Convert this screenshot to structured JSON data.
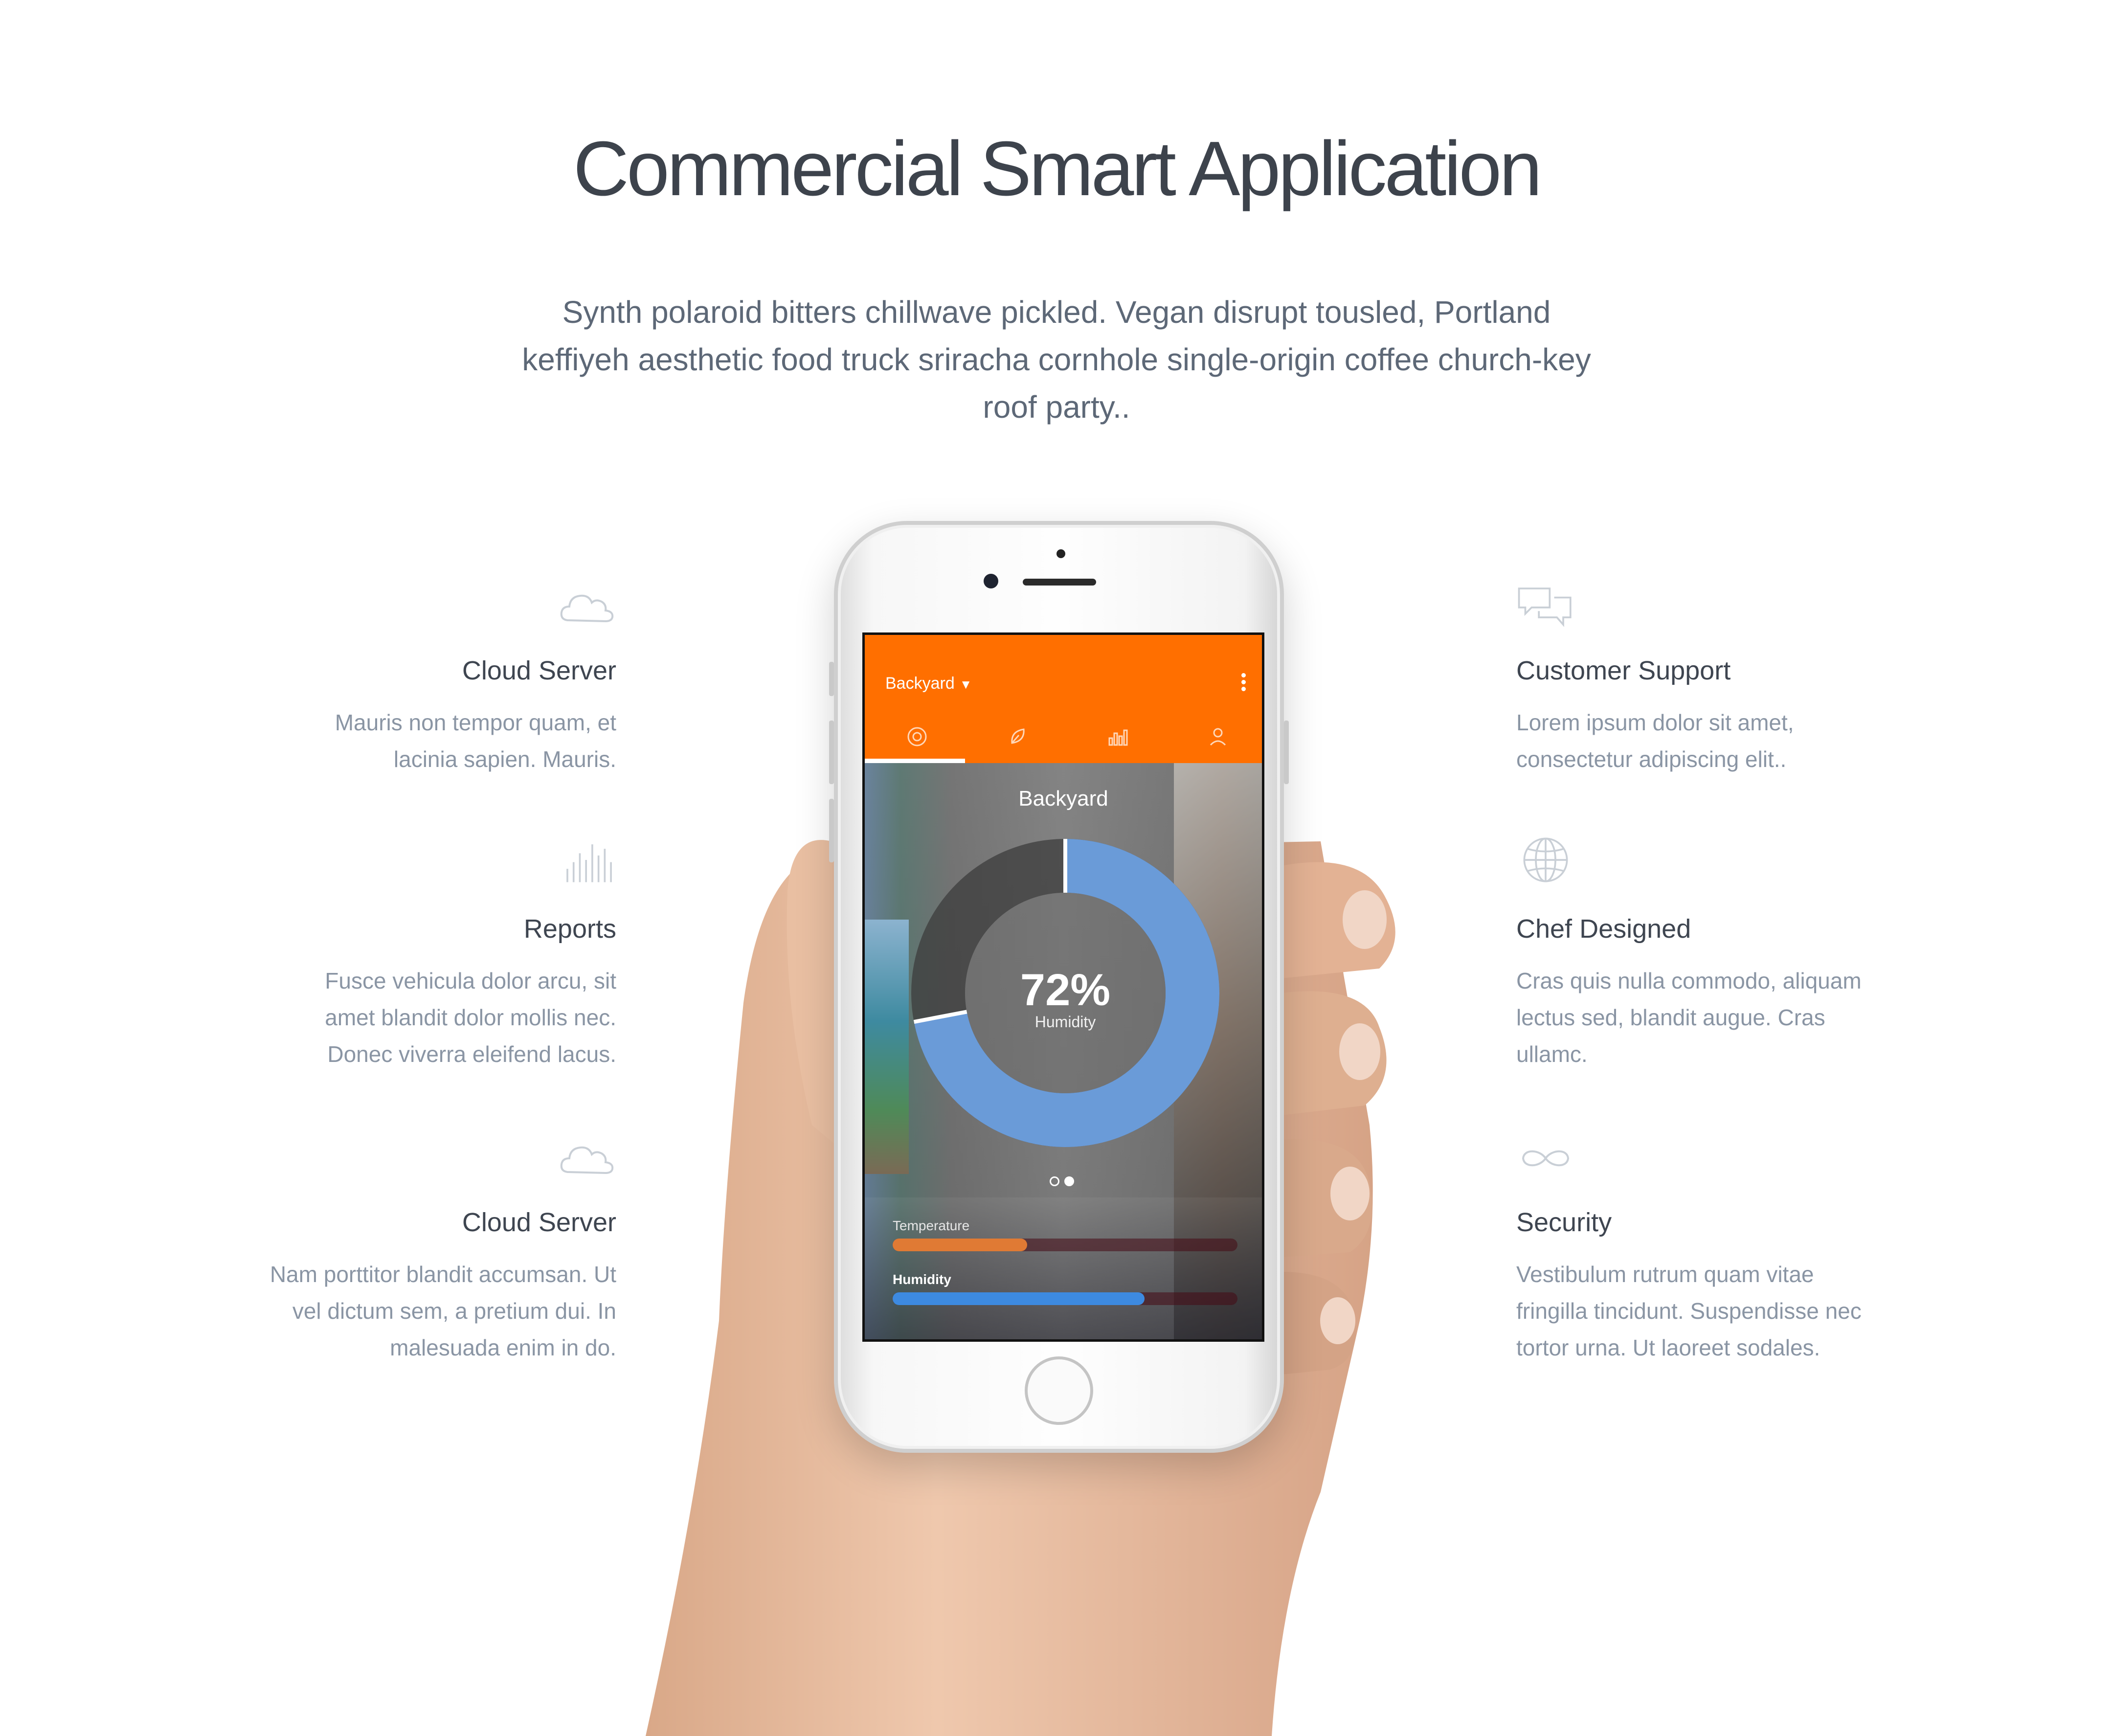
{
  "page": {
    "headline": "Commercial Smart Application",
    "lede": "Synth polaroid bitters chillwave pickled. Vegan disrupt tousled, Portland keffiyeh aesthetic food truck sriracha cornhole single-origin coffee church-key roof party.."
  },
  "features_left": [
    {
      "icon": "cloud-icon",
      "title": "Cloud Server",
      "desc": "Mauris non tempor quam, et lacinia sapien. Mauris."
    },
    {
      "icon": "bar-chart-icon",
      "title": "Reports",
      "desc": "Fusce vehicula dolor arcu, sit amet blandit dolor mollis nec. Donec viverra eleifend lacus."
    },
    {
      "icon": "cloud-icon",
      "title": "Cloud Server",
      "desc": "Nam porttitor blandit accumsan. Ut vel dictum sem, a pretium dui. In malesuada enim in do."
    }
  ],
  "features_right": [
    {
      "icon": "chat-bubbles-icon",
      "title": "Customer Support",
      "desc": "Lorem ipsum dolor sit amet, consectetur adipiscing elit.."
    },
    {
      "icon": "globe-icon",
      "title": "Chef Designed",
      "desc": "Cras quis nulla commodo, aliquam lectus sed, blandit augue. Cras ullamc."
    },
    {
      "icon": "infinity-icon",
      "title": "Security",
      "desc": "Vestibulum rutrum quam vitae fringilla tincidunt. Suspendisse nec tortor urna. Ut laoreet sodales."
    }
  ],
  "app": {
    "location_selector": "Backyard",
    "tabs": [
      "target-icon",
      "leaf-icon",
      "chart-icon",
      "user-icon"
    ],
    "active_tab": 0,
    "place_title": "Backyard",
    "gauge": {
      "value_label": "72%",
      "label": "Humidity",
      "fraction": 0.72
    },
    "pager": {
      "count": 2,
      "active": 1
    },
    "bars": [
      {
        "label": "Temperature",
        "fraction": 0.39,
        "color": "#e07a34"
      },
      {
        "label": "Humidity",
        "fraction": 0.73,
        "color": "#3d8ae0"
      }
    ]
  },
  "colors": {
    "accent": "#ff6f00",
    "gauge": "#6a9bd8",
    "headline": "#3d434c",
    "body_text": "#8a95a4"
  }
}
